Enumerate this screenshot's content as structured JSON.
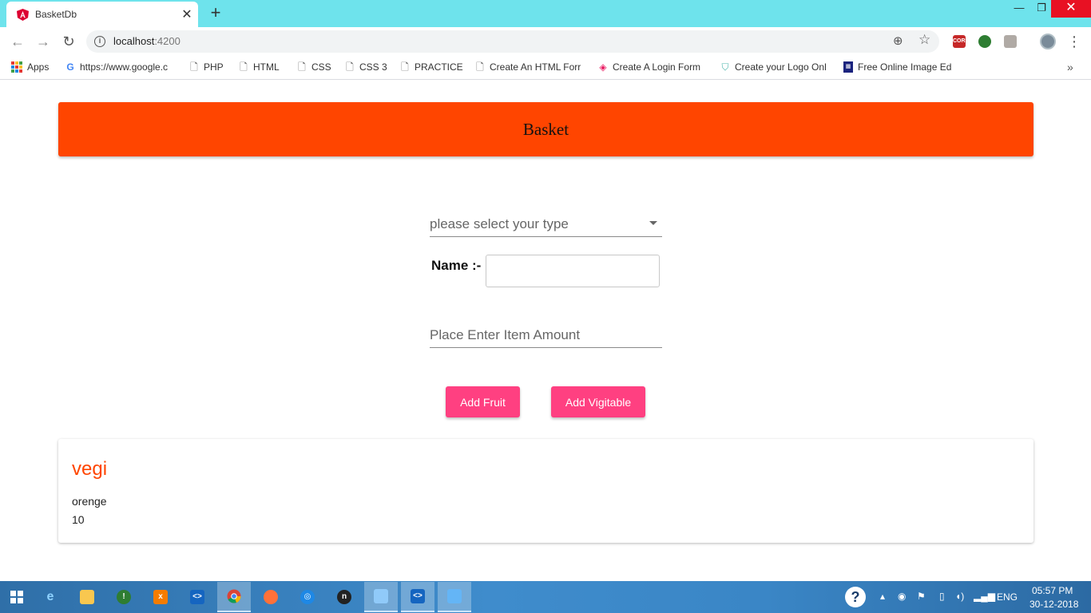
{
  "browser": {
    "tab_title": "BasketDb",
    "tab_close": "✕",
    "new_tab": "+",
    "url_host": "localhost",
    "url_port": ":4200",
    "bookmarks": [
      {
        "label": "Apps",
        "icon": "apps-grid-icon"
      },
      {
        "label": "https://www.google.c",
        "icon": "google-icon"
      },
      {
        "label": "PHP",
        "icon": "page-icon"
      },
      {
        "label": "HTML",
        "icon": "page-icon"
      },
      {
        "label": "CSS",
        "icon": "page-icon"
      },
      {
        "label": "CSS 3",
        "icon": "page-icon"
      },
      {
        "label": "PRACTICE",
        "icon": "page-icon"
      },
      {
        "label": "Create An HTML Forr",
        "icon": "page-icon"
      },
      {
        "label": "Create A Login Form",
        "icon": "form-icon"
      },
      {
        "label": "Create your Logo Onl",
        "icon": "logo-icon"
      },
      {
        "label": "Free Online Image Ed",
        "icon": "image-editor-icon"
      }
    ],
    "bookmarks_more": "»",
    "extensions": [
      "CORS"
    ]
  },
  "page": {
    "header_title": "Basket",
    "type_select_placeholder": "please select your type",
    "name_label": "Name :-",
    "name_value": "",
    "amount_placeholder": "Place Enter Item Amount",
    "add_fruit_label": "Add Fruit",
    "add_vegetable_label": "Add Vigitable",
    "card": {
      "title": "vegi",
      "item_name": "orenge",
      "item_amount": "10"
    }
  },
  "taskbar": {
    "language": "ENG",
    "time": "05:57 PM",
    "date": "30-12-2018"
  },
  "colors": {
    "header": "#ff4500",
    "button": "#ff4081",
    "card_title": "#ff4500",
    "tabstrip": "#6ee3ec"
  }
}
